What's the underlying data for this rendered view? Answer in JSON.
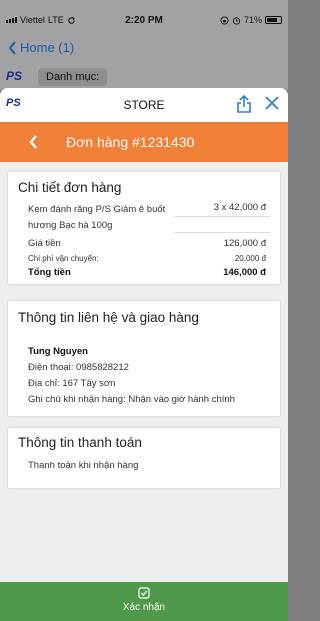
{
  "status_bar": {
    "carrier": "Viettel",
    "network": "LTE",
    "time": "2:20 PM",
    "battery": "71%"
  },
  "background": {
    "back_label": "Home (1)",
    "category_label": "Danh mục:",
    "logo_text": "PS"
  },
  "store_bar": {
    "logo_text": "PS",
    "title": "STORE"
  },
  "order_header": {
    "title": "Đơn hàng #1231430"
  },
  "order_details": {
    "heading": "Chi tiết đơn hàng",
    "item_name": "Kem đánh răng P/S Giảm ê buốt hương Bạc hà 100g",
    "item_qty": "3 x 42,000 đ",
    "price_label": "Giá tiền",
    "price_value": "126,000 đ",
    "shipping_label": "Chi phí vận chuyển:",
    "shipping_value": "20,000 đ",
    "total_label": "Tổng tiền",
    "total_value": "146,000 đ"
  },
  "contact": {
    "heading": "Thông tin liên hệ và giao hàng",
    "name": "Tung Nguyen",
    "phone": "Điện thoại: 0985828212",
    "address": "Địa chỉ: 167 Tây sơn",
    "note": "Ghi chú khi nhận hàng: Nhận vào giờ hành chính"
  },
  "payment": {
    "heading": "Thông tin thanh toán",
    "method": "Thanh toán khi nhận hàng"
  },
  "confirm": {
    "label": "Xác nhận"
  },
  "colors": {
    "accent_orange": "#f07f38",
    "confirm_green": "#4f9a4a",
    "link_blue": "#1b5aa8"
  }
}
